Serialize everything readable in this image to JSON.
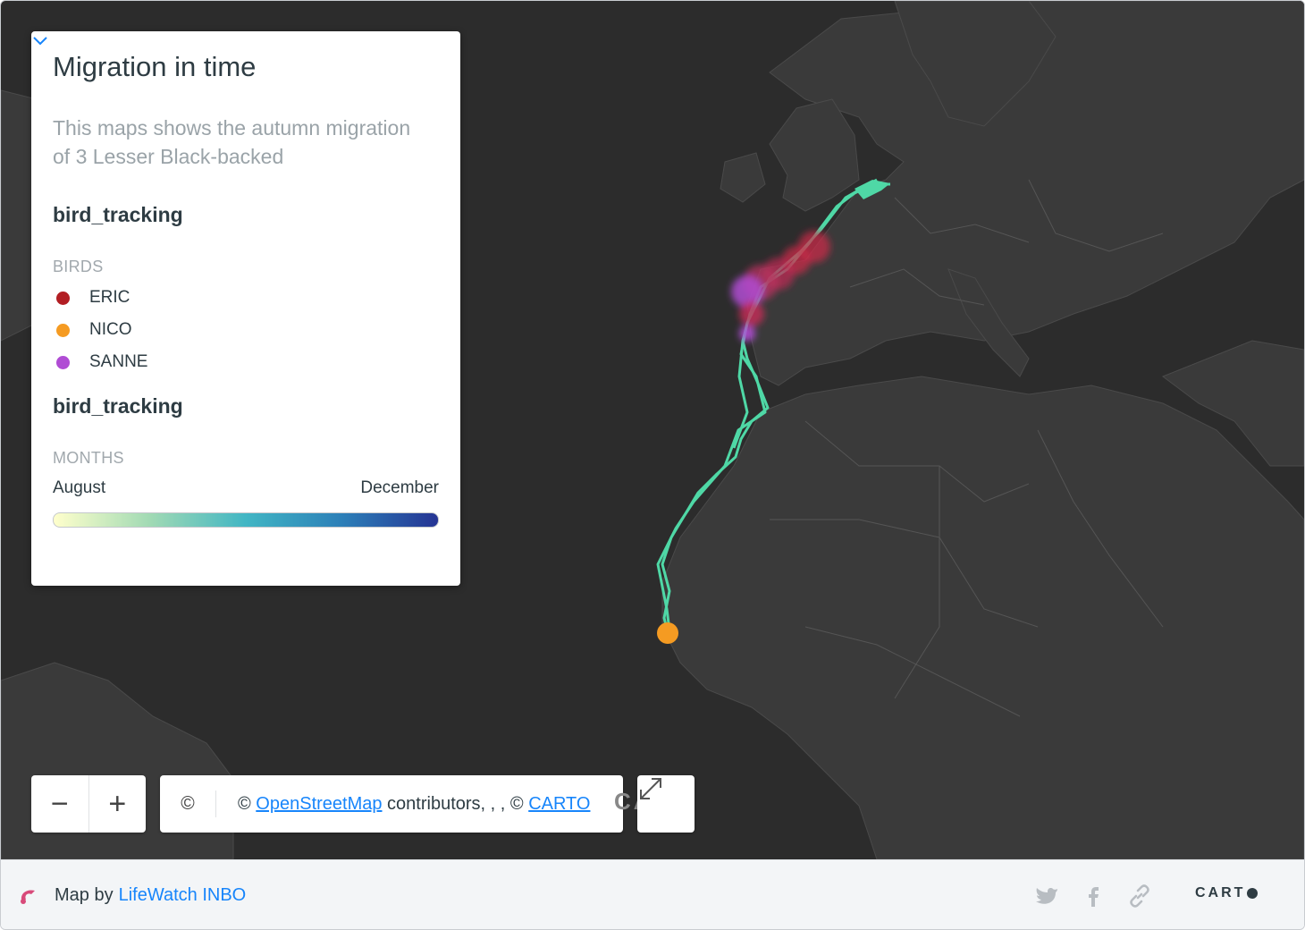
{
  "legend": {
    "title": "Migration in time",
    "description": "This maps shows the autumn migration of 3 Lesser Black-backed",
    "layer1": {
      "title": "bird_tracking",
      "caption": "BIRDS",
      "birds": [
        {
          "name": "ERIC",
          "color": "#b21e23"
        },
        {
          "name": "NICO",
          "color": "#f59b22"
        },
        {
          "name": "SANNE",
          "color": "#b04cd4"
        }
      ]
    },
    "layer2": {
      "title": "bird_tracking",
      "caption": "MONTHS",
      "from": "August",
      "to": "December"
    }
  },
  "controls": {
    "zoom_out": "−",
    "zoom_in": "+",
    "copyright_symbol": "©",
    "attribution_prefix": "© ",
    "osm_link": "OpenStreetMap",
    "attribution_middle": " contributors, , , © ",
    "carto_link": "CARTO",
    "watermark": "CART"
  },
  "footer": {
    "map_by": "Map by",
    "author": "LifeWatch INBO",
    "carto": "CART"
  },
  "colors": {
    "track": "#4fd8a6",
    "map_bg": "#2c2c2c",
    "land": "#3a3a3a",
    "accent": "#1785fb"
  }
}
